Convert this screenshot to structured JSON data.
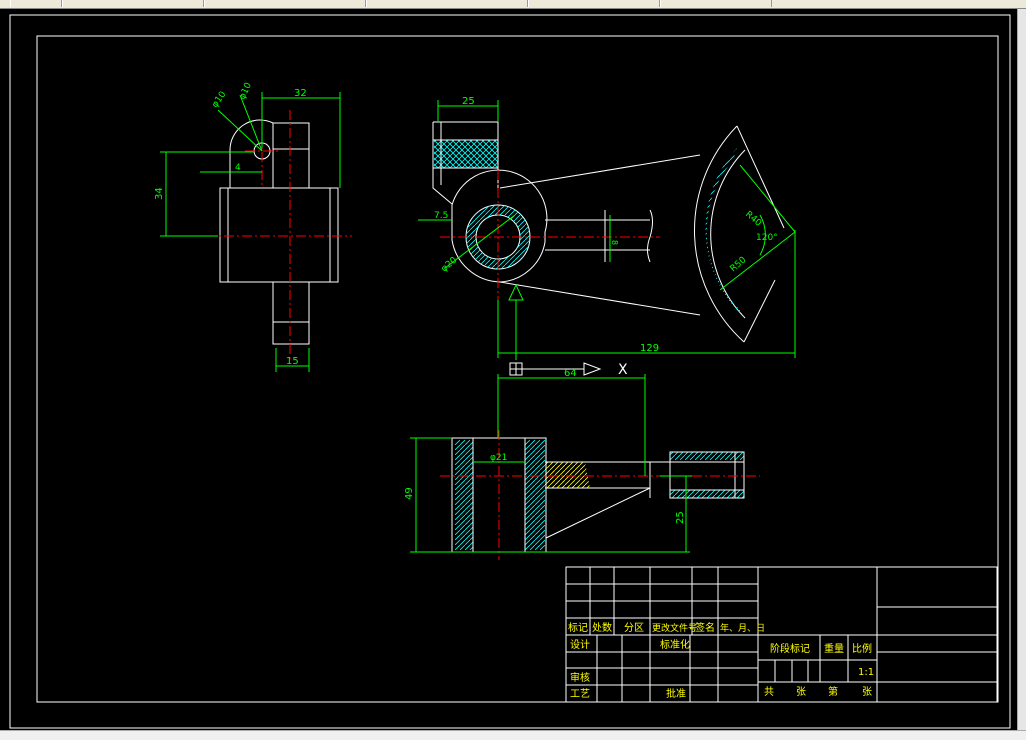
{
  "drawing": {
    "dimensions": {
      "d_phi10": "φ10",
      "d_r10": "φ10",
      "d_32": "32",
      "d_4": "4",
      "d_34": "34",
      "d_15": "15",
      "d_25": "25",
      "d_7_5": "7.5",
      "d_phi20": "φ20",
      "d_8": "8",
      "d_r40": "R40",
      "d_120": "120°",
      "d_r50": "R50",
      "d_129": "129",
      "d_64": "64",
      "d_x": "X",
      "d_phi21": "φ21",
      "d_49": "49",
      "d_25b": "25"
    },
    "title_block": {
      "biaoji": "标记",
      "chushu": "处数",
      "fenqu": "分区",
      "genggai": "更改文件号",
      "qianming": "签名",
      "nianyueri": "年、月、日",
      "sheji": "设计",
      "biaozhunhua": "标准化",
      "jieduan": "阶段标记",
      "zhongliang": "重量",
      "bili": "比例",
      "bili_value": "1:1",
      "shenhe": "审核",
      "gongyi": "工艺",
      "pizhun": "批准",
      "gong": "共",
      "zhang1": "张",
      "di": "第",
      "zhang2": "张"
    }
  },
  "colors": {
    "background": "#000000",
    "outline": "#ffffff",
    "dimension": "#00ff00",
    "centerline": "#ff0000",
    "hatch": "#00ffff"
  }
}
